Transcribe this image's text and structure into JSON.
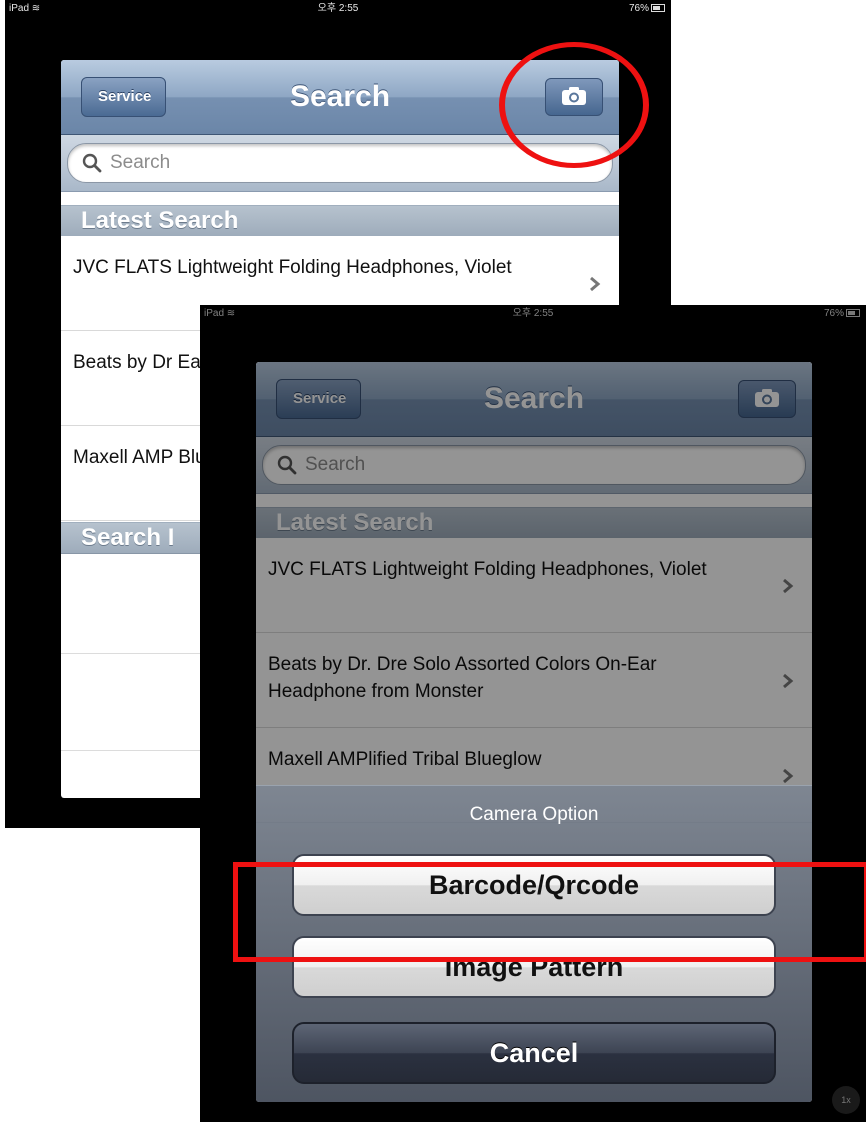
{
  "status_bar": {
    "carrier": "iPad",
    "time": "오후 2:55",
    "battery": "76%"
  },
  "nav": {
    "back_label": "Service",
    "title": "Search",
    "camera_icon": "camera-icon"
  },
  "search": {
    "placeholder": "Search"
  },
  "sections": {
    "latest": "Latest Search",
    "search_history_partial": "Search I"
  },
  "back_screen_rows": [
    {
      "text": "JVC FLATS Lightweight Folding Headphones, Violet"
    },
    {
      "text": "Beats by Dr Ear Headph"
    },
    {
      "text": "Maxell AMP Blueglow"
    }
  ],
  "front_screen_rows": [
    {
      "text": "JVC FLATS Lightweight Folding Headphones, Violet"
    },
    {
      "text": "Beats by Dr. Dre Solo Assorted Colors On-Ear Headphone from Monster"
    },
    {
      "text": "Maxell AMPlified Tribal Blueglow"
    }
  ],
  "action_sheet": {
    "title": "Camera Option",
    "barcode_label": "Barcode/Qrcode",
    "image_pattern_label": "Image Pattern",
    "cancel_label": "Cancel"
  },
  "zoom_badge": "1x",
  "annotation_color": "#ee1111"
}
